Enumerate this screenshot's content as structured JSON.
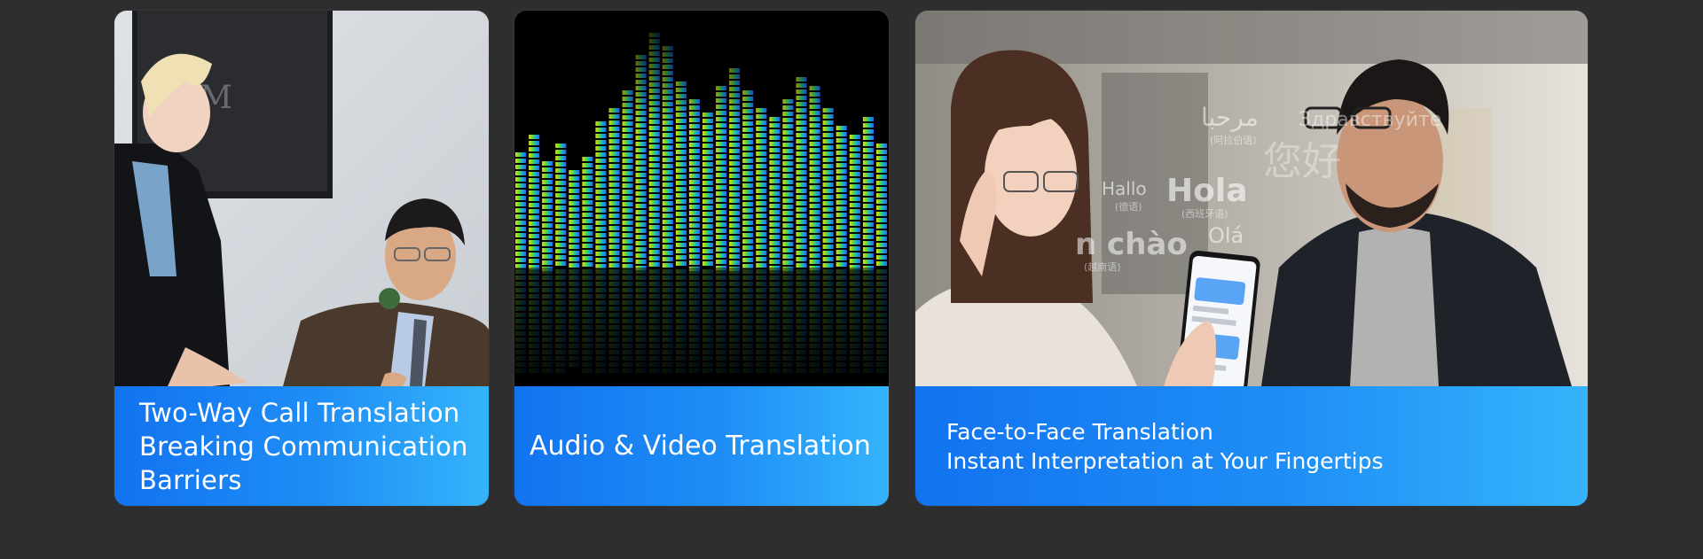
{
  "cards": [
    {
      "image_label": "business-handshake-photo",
      "sign_text": "AM",
      "caption_lines": [
        "Two-Way Call Translation",
        "Breaking Communication",
        "Barriers"
      ]
    },
    {
      "image_label": "audio-equalizer-visual",
      "caption_lines": [
        "Audio & Video Translation"
      ]
    },
    {
      "image_label": "face-to-face-conversation-photo",
      "greetings": [
        {
          "word": "مرحبا",
          "sub": "(阿拉伯语)"
        },
        {
          "word": "Здравствуйте",
          "sub": ""
        },
        {
          "word": "您好",
          "sub": ""
        },
        {
          "word": "Hallo",
          "sub": "(德语)"
        },
        {
          "word": "Hola",
          "sub": "(西班牙语)"
        },
        {
          "word": "n chào",
          "sub": "(越南语)"
        },
        {
          "word": "Olá",
          "sub": ""
        }
      ],
      "caption_lines": [
        "Face-to-Face Translation",
        "Instant Interpretation at Your Fingertips"
      ]
    }
  ],
  "colors": {
    "page_bg": "#2e2e2e",
    "caption_start": "#1273f0",
    "caption_end": "#35b4fb"
  }
}
